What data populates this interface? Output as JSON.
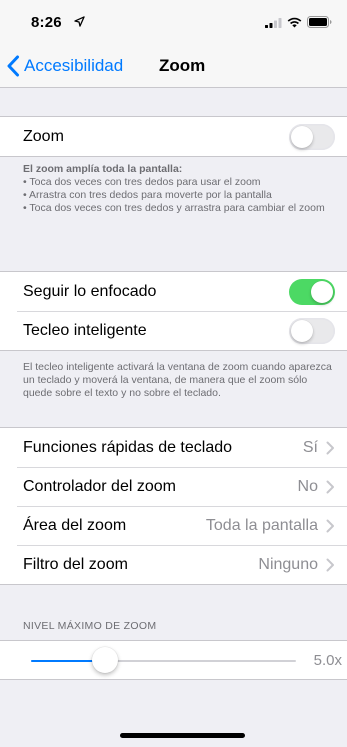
{
  "status": {
    "time": "8:26"
  },
  "nav": {
    "back_label": "Accesibilidad",
    "title": "Zoom"
  },
  "zoom": {
    "label": "Zoom",
    "enabled": false
  },
  "zoom_footer": {
    "title": "El zoom amplía toda la pantalla:",
    "lines": [
      "• Toca dos veces con tres dedos para usar el zoom",
      "• Arrastra con tres dedos para moverte por la pantalla",
      "• Toca dos veces con tres dedos y arrastra para cambiar el zoom"
    ]
  },
  "follow_focus": {
    "label": "Seguir lo enfocado",
    "enabled": true
  },
  "smart_typing": {
    "label": "Tecleo inteligente",
    "enabled": false
  },
  "smart_typing_footer": "El tecleo inteligente activará la ventana de zoom cuando aparezca un teclado y moverá la ventana, de manera que el zoom sólo quede sobre el texto y no sobre el teclado.",
  "settings": [
    {
      "label": "Funciones rápidas de teclado",
      "value": "Sí"
    },
    {
      "label": "Controlador del zoom",
      "value": "No"
    },
    {
      "label": "Área del zoom",
      "value": "Toda la pantalla"
    },
    {
      "label": "Filtro del zoom",
      "value": "Ninguno"
    }
  ],
  "max_zoom": {
    "header": "NIVEL MÁXIMO DE ZOOM",
    "value": "5.0x",
    "fraction": 0.28
  },
  "colors": {
    "accent": "#007aff",
    "toggle_on": "#4cd964",
    "background": "#efeff4"
  },
  "icons": [
    "location-arrow-icon",
    "signal-icon",
    "wifi-icon",
    "battery-icon",
    "back-chevron-icon",
    "chevron-right-icon"
  ]
}
